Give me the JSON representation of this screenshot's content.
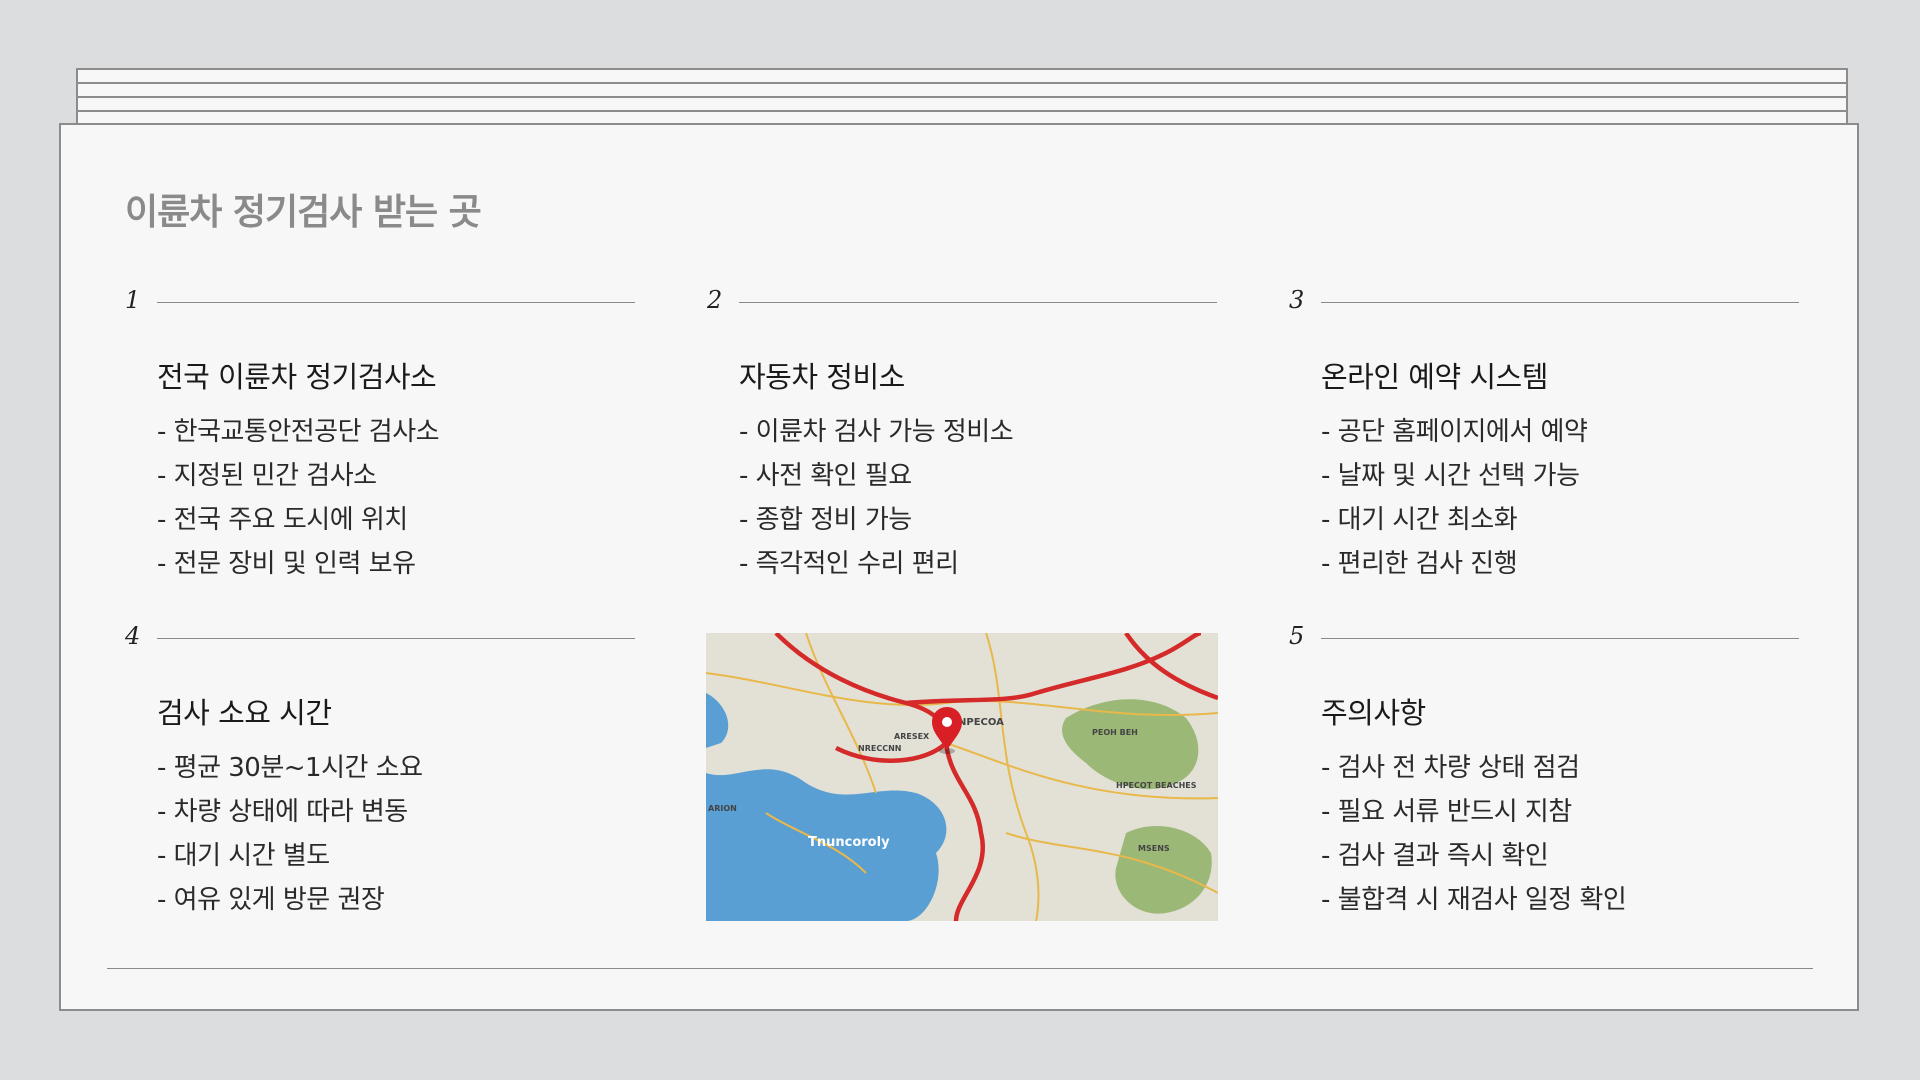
{
  "page": {
    "title": "이륜차 정기검사 받는 곳"
  },
  "sections": [
    {
      "number": "1",
      "title": "전국 이륜차 정기검사소",
      "items": [
        "- 한국교통안전공단 검사소",
        "- 지정된 민간 검사소",
        "- 전국 주요 도시에 위치",
        "- 전문 장비 및 인력 보유"
      ]
    },
    {
      "number": "2",
      "title": "자동차 정비소",
      "items": [
        "- 이륜차 검사 가능 정비소",
        "- 사전 확인 필요",
        "- 종합 정비 가능",
        "- 즉각적인 수리 편리"
      ]
    },
    {
      "number": "3",
      "title": "온라인 예약 시스템",
      "items": [
        "- 공단 홈페이지에서 예약",
        "- 날짜 및 시간 선택 가능",
        "- 대기 시간 최소화",
        "- 편리한 검사 진행"
      ]
    },
    {
      "number": "4",
      "title": "검사 소요 시간",
      "items": [
        "- 평균 30분~1시간 소요",
        "- 차량 상태에 따라 변동",
        "- 대기 시간 별도",
        "- 여유 있게 방문 권장"
      ]
    },
    {
      "number": "5",
      "title": "주의사항",
      "items": [
        "- 검사 전 차량 상태 점검",
        "- 필요 서류 반드시 지참",
        "- 검사 결과 즉시 확인",
        "- 불합격 시 재검사 일정 확인"
      ]
    }
  ],
  "map_image": {
    "labels": [
      "NPECOA",
      "Tnuncoroly",
      "PEOH BEH",
      "HPECOT BEACHES",
      "MSENS",
      "ARESEX",
      "NRECCNN",
      "ARION"
    ],
    "colors": {
      "water": "#5a9fd4",
      "land": "#e3e1d6",
      "park": "#8fb066",
      "road_main": "#d42a2a",
      "road_minor": "#e8b84a",
      "pin": "#d91f26"
    }
  }
}
